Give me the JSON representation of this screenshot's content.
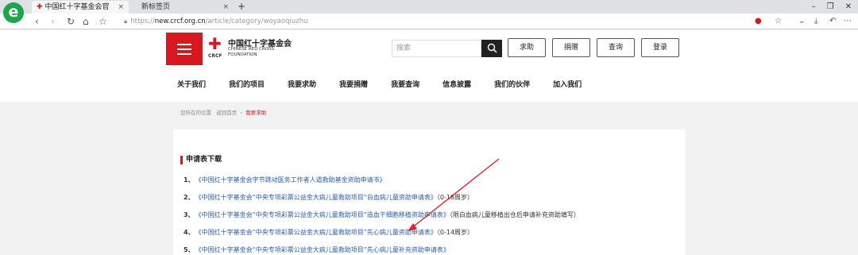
{
  "browser": {
    "logo": "e",
    "tabs": [
      {
        "label": "中国红十字基金会官",
        "close": "×"
      },
      {
        "label": "新标签页",
        "close": "×"
      }
    ],
    "new_tab": "+",
    "window_controls": [
      "–",
      "❐",
      "✕"
    ],
    "url_scheme": "https://",
    "url_host": "new.crcf.org.cn",
    "url_path": "/article/category/woyaoqiuzhu"
  },
  "header": {
    "logo_cn": "中国红十字基金会",
    "logo_en_line1": "CHINESE RED CROSS",
    "logo_en_line2": "FOUNDATION",
    "logo_abbr": "CRCF",
    "search_placeholder": "搜索",
    "buttons": [
      "求助",
      "捐赠",
      "查询",
      "登录"
    ]
  },
  "nav": [
    "关于我们",
    "我们的项目",
    "我要求助",
    "我要捐赠",
    "我要查询",
    "信息披露",
    "我们的伙伴",
    "加入我们"
  ],
  "breadcrumb": {
    "prefix": "您所在的位置",
    "home": "返回首页",
    "sep": "›",
    "current": "我要求助"
  },
  "content": {
    "section_title": "申请表下载",
    "items": [
      {
        "num": "1、",
        "link": "《中国红十字基金会字节跳动医务工作者人道救助基金资助申请书》",
        "note": ""
      },
      {
        "num": "2、",
        "link": "《中国红十字基金会“中央专项彩票公益金大病儿童救助项目”白血病儿童资助申请表》",
        "note": "（0-18周岁）"
      },
      {
        "num": "3、",
        "link": "《中国红十字基金会“中央专项彩票公益金大病儿童救助项目”造血干细胞移植资助申请表》",
        "note": "（限白血病儿童移植出仓后申请补充资助填写）"
      },
      {
        "num": "4、",
        "link": "《中国红十字基金会“中央专项彩票公益金大病儿童救助项目”先心病儿童资助申请表》",
        "note": "（0-14周岁）"
      },
      {
        "num": "5、",
        "link": "《中国红十字基金会“中央专项彩票公益金大病儿童救助项目”先心病儿童补充资助申请表》",
        "note": ""
      }
    ]
  },
  "colors": {
    "brand_red": "#d7191f",
    "link_blue": "#2a5db0",
    "arrow": "#e0202a"
  }
}
